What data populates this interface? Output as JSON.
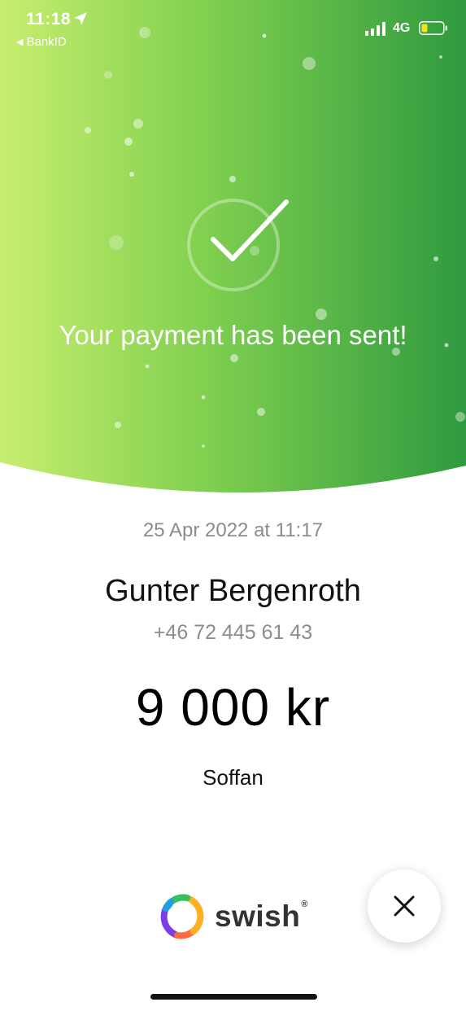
{
  "status_bar": {
    "time": "11:18",
    "back_app": "BankID",
    "network": "4G",
    "battery_color": "#f5e21b"
  },
  "confirmation": {
    "message": "Your payment has been sent!",
    "gradient_start": "#c8ee6e",
    "gradient_end": "#2f9a3f"
  },
  "payment": {
    "date": "25 Apr 2022 at 11:17",
    "recipient_name": "Gunter Bergenroth",
    "recipient_phone": "+46 72 445 61 43",
    "amount": "9 000 kr",
    "message": "Soffan"
  },
  "footer": {
    "brand_name": "swish",
    "registered_mark": "®",
    "close_icon": "close-icon"
  }
}
